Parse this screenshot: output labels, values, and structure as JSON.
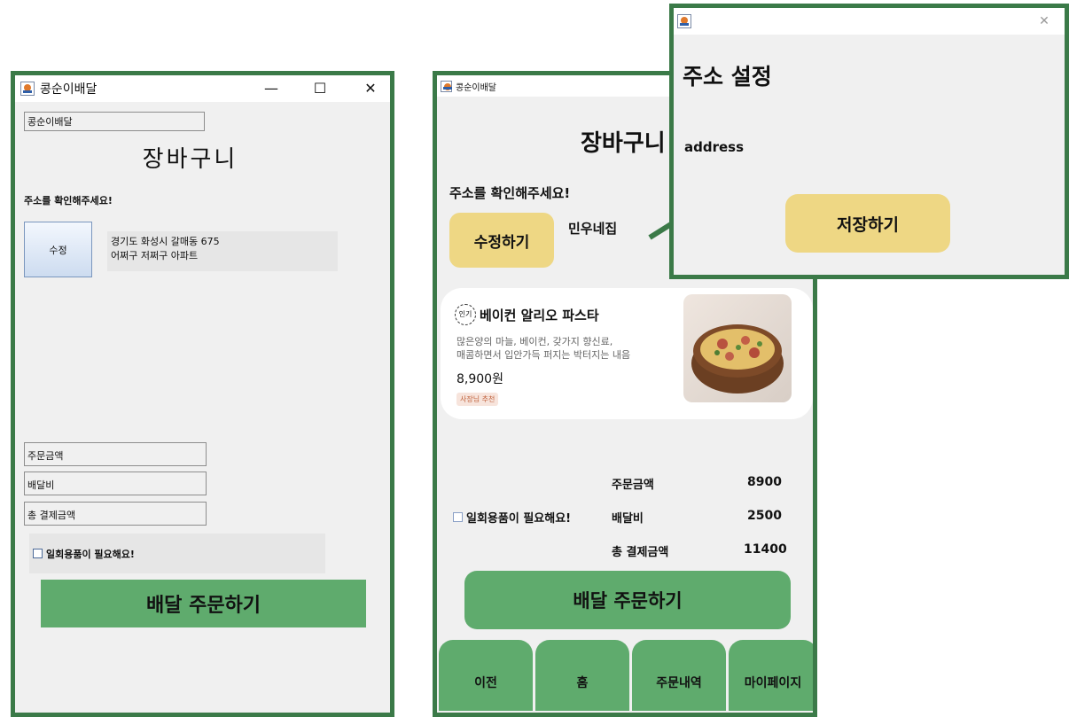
{
  "left_window": {
    "title": "콩순이배달",
    "controls": {
      "minimize": "—",
      "maximize": "☐",
      "close": "✕"
    },
    "top_field": "콩순이배달",
    "heading": "장바구니",
    "address_prompt": "주소를 확인해주세요!",
    "edit_button": "수정",
    "address_line1": "경기도 화성시 갈매동 675",
    "address_line2": "어쩌구 저쩌구 아파트",
    "order_amount_field": "주문금액",
    "delivery_fee_field": "배달비",
    "total_field": "총 결제금액",
    "disposable_checkbox": "일회용품이 필요해요!",
    "order_button": "배달 주문하기"
  },
  "right_window": {
    "title": "콩순이배달",
    "heading": "장바구니",
    "address_prompt": "주소를 확인해주세요!",
    "edit_button": "수정하기",
    "address_name": "민우네집",
    "menu_item": {
      "badge": "인기",
      "name": "베이컨 알리오 파스타",
      "desc_line1": "많은양의 마늘, 베이컨, 갖가지 향신료,",
      "desc_line2": "매콤하면서 입안가득 퍼지는 박터지는 내음",
      "price": "8,900원",
      "tag": "사장님 추천"
    },
    "order_amount_label": "주문금액",
    "order_amount_value": "8900",
    "disposable_checkbox": "일회용품이 필요해요!",
    "delivery_fee_label": "배달비",
    "delivery_fee_value": "2500",
    "total_label": "총 결제금액",
    "total_value": "11400",
    "order_button": "배달 주문하기",
    "tabs": [
      "이전",
      "홈",
      "주문내역",
      "마이페이지"
    ]
  },
  "dialog": {
    "close": "✕",
    "heading": "주소 설정",
    "address_text": "address",
    "save_button": "저장하기"
  },
  "colors": {
    "frame_border": "#3b7a48",
    "primary_green": "#5fab6d",
    "edit_yellow": "#eed784",
    "background": "#f0f0f0"
  }
}
